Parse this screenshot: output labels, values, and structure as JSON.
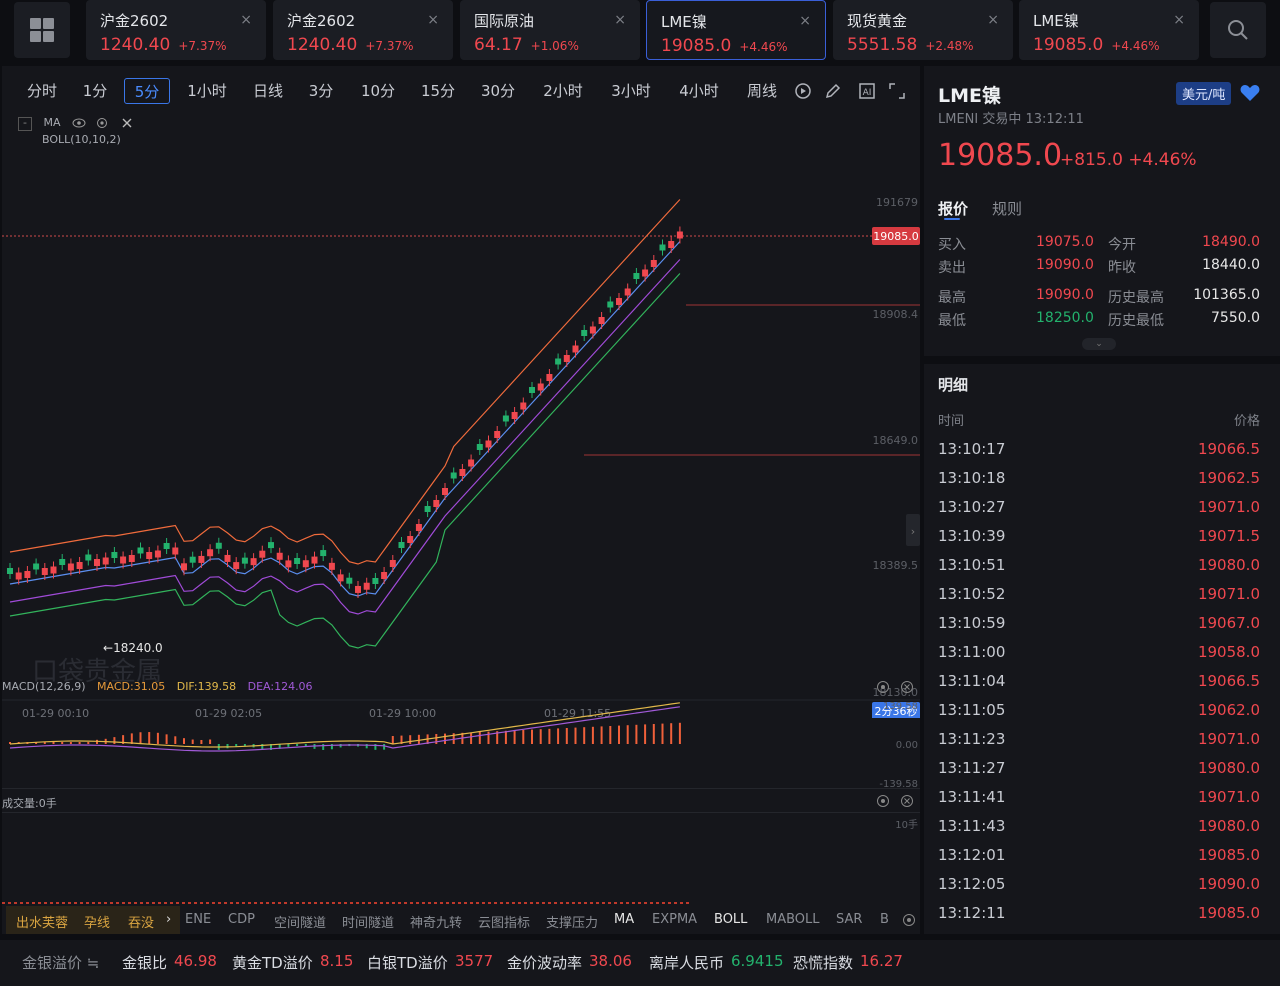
{
  "tabs": [
    {
      "name": "沪金2602",
      "price": "1240.40",
      "pct": "+7.37%"
    },
    {
      "name": "沪金2602",
      "price": "1240.40",
      "pct": "+7.37%"
    },
    {
      "name": "国际原油",
      "price": "64.17",
      "pct": "+1.06%"
    },
    {
      "name": "LME镍",
      "price": "19085.0",
      "pct": "+4.46%"
    },
    {
      "name": "现货黄金",
      "price": "5551.58",
      "pct": "+2.48%"
    },
    {
      "name": "LME镍",
      "price": "19085.0",
      "pct": "+4.46%"
    }
  ],
  "close_glyph": "×",
  "periods": [
    "分时",
    "1分",
    "5分",
    "1小时",
    "日线",
    "3分",
    "10分",
    "15分",
    "30分",
    "2小时",
    "3小时",
    "4小时",
    "周线"
  ],
  "indicator": {
    "ma": "MA",
    "boll": "BOLL(10,10,2)",
    "collapse": "-"
  },
  "price_axis": {
    "top": "191679",
    "current": "19085.0",
    "l2": "18908.4",
    "l3": "18649.0",
    "l4": "18389.5",
    "bottom": "18130.0"
  },
  "low_marker": "18240.0",
  "watermark": "口袋贵金属",
  "time_axis": [
    "01-29 00:10",
    "01-29 02:05",
    "01-29 10:00",
    "01-29 11:55"
  ],
  "countdown": "2分36秒",
  "macd": {
    "label": "MACD(12,26,9)",
    "macd": "MACD:31.05",
    "dif": "DIF:139.58",
    "dea": "DEA:124.06",
    "axis_top": "139.58",
    "axis_mid": "0.00",
    "axis_bot": "-139.58"
  },
  "volume": {
    "label": "成交量:0手",
    "axis": "10手"
  },
  "indicator_tabs": [
    "出水芙蓉",
    "孕线",
    "吞没",
    "ENE",
    "CDP",
    "空间隧道",
    "时间隧道",
    "神奇九转",
    "云图指标",
    "支撑压力",
    "MA",
    "EXPMA",
    "BOLL",
    "MABOLL",
    "SAR",
    "B"
  ],
  "side": {
    "title": "LME镍",
    "sub": "LMENI 交易中 13:12:11",
    "unit": "美元/吨",
    "price": "19085.0",
    "change": "+815.0 +4.46%",
    "tab_quote": "报价",
    "tab_rules": "规则",
    "quotes": [
      {
        "l1": "买入",
        "v1": "19075.0",
        "l2": "今开",
        "v2": "18490.0"
      },
      {
        "l1": "卖出",
        "v1": "19090.0",
        "l2": "昨收",
        "v2": "18440.0"
      },
      {
        "l1": "最高",
        "v1": "19090.0",
        "l2": "历史最高",
        "v2": "101365.0"
      },
      {
        "l1": "最低",
        "v1": "18250.0",
        "l2": "历史最低",
        "v2": "7550.0"
      }
    ],
    "detail_title": "明细",
    "col_time": "时间",
    "col_price": "价格",
    "trades": [
      [
        "13:10:17",
        "19066.5"
      ],
      [
        "13:10:18",
        "19062.5"
      ],
      [
        "13:10:27",
        "19071.0"
      ],
      [
        "13:10:39",
        "19071.5"
      ],
      [
        "13:10:51",
        "19080.0"
      ],
      [
        "13:10:52",
        "19071.0"
      ],
      [
        "13:10:59",
        "19067.0"
      ],
      [
        "13:11:00",
        "19058.0"
      ],
      [
        "13:11:04",
        "19066.5"
      ],
      [
        "13:11:05",
        "19062.0"
      ],
      [
        "13:11:23",
        "19071.0"
      ],
      [
        "13:11:27",
        "19080.0"
      ],
      [
        "13:11:41",
        "19071.0"
      ],
      [
        "13:11:43",
        "19080.0"
      ],
      [
        "13:12:01",
        "19085.0"
      ],
      [
        "13:12:05",
        "19090.0"
      ],
      [
        "13:12:11",
        "19085.0"
      ]
    ]
  },
  "bottom": [
    {
      "label": "金银溢价 ≒",
      "value": ""
    },
    {
      "label": "金银比",
      "value": "46.98"
    },
    {
      "label": "黄金TD溢价",
      "value": "8.15"
    },
    {
      "label": "白银TD溢价",
      "value": "3577"
    },
    {
      "label": "金价波动率",
      "value": "38.06"
    },
    {
      "label": "离岸人民币",
      "value": "6.9415"
    },
    {
      "label": "恐慌指数",
      "value": "16.27"
    }
  ],
  "colors": {
    "up": "#f0484f",
    "down": "#23b26d",
    "accent": "#3a76e8"
  }
}
